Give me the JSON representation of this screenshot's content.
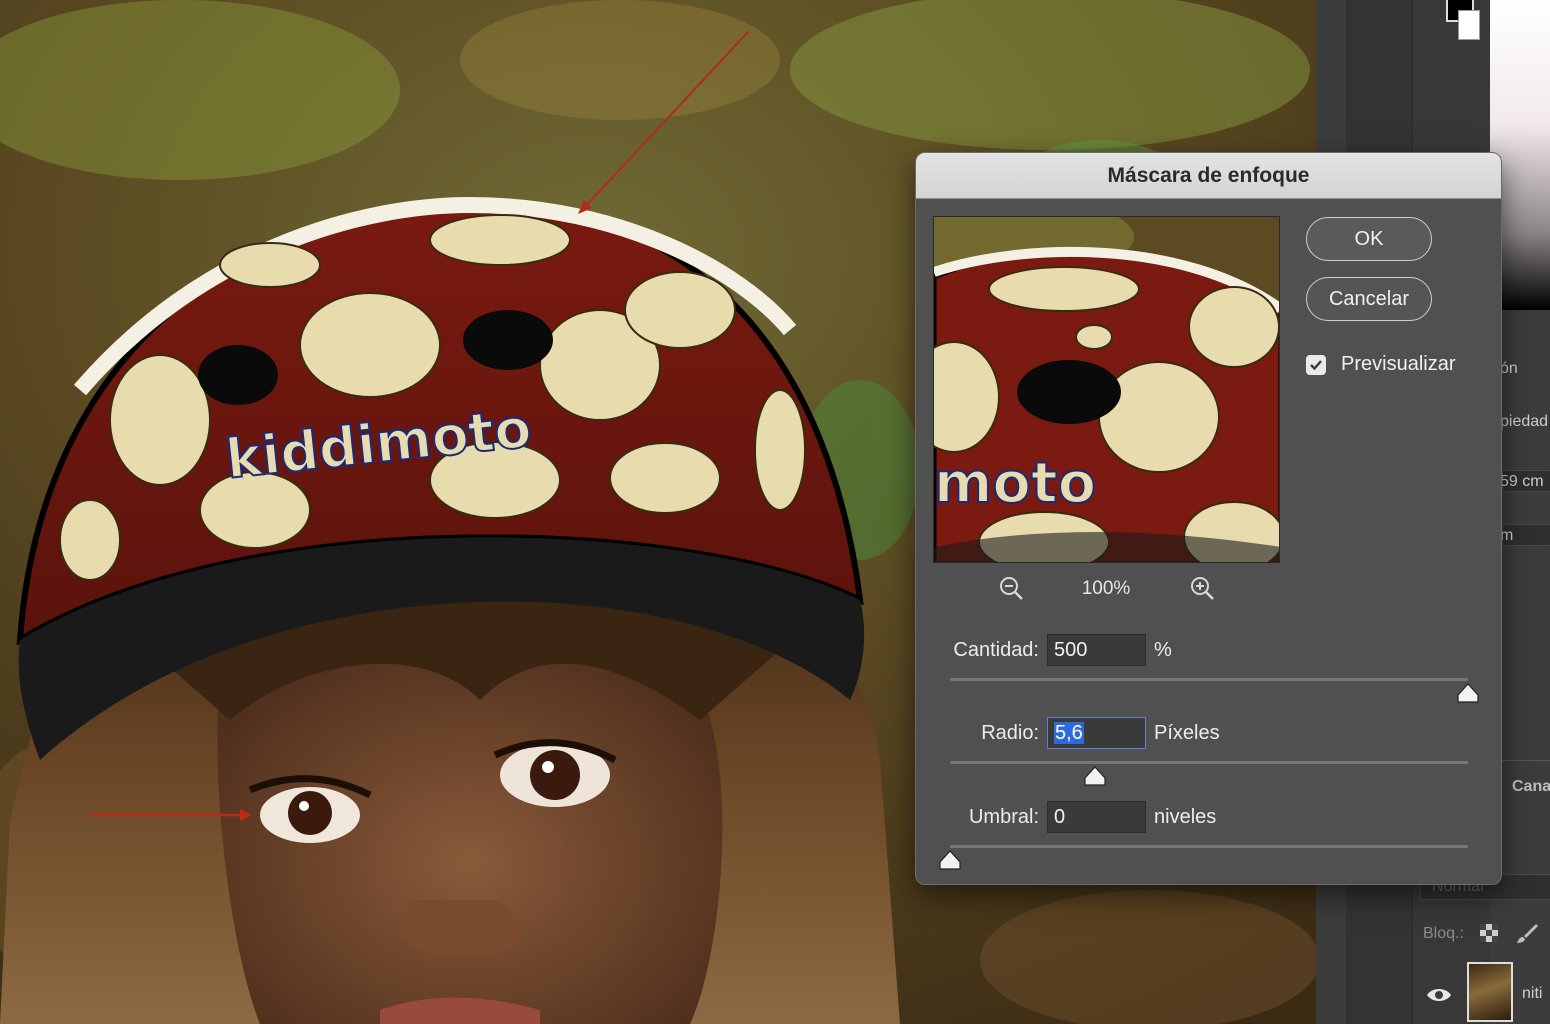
{
  "dialog": {
    "title": "Máscara de enfoque",
    "ok_label": "OK",
    "cancel_label": "Cancelar",
    "preview_label": "Previsualizar",
    "preview_checked": true,
    "zoom_level": "100%",
    "amount": {
      "label": "Cantidad:",
      "value": "500",
      "unit": "%",
      "slider_fraction": 1.0
    },
    "radius": {
      "label": "Radio:",
      "value": "5,6",
      "unit": "Píxeles",
      "slider_fraction": 0.28
    },
    "threshold": {
      "label": "Umbral:",
      "value": "0",
      "unit": "niveles",
      "slider_fraction": 0.0
    }
  },
  "canvas": {
    "helmet_brand_text": "kiddimoto",
    "preview_brand_text": "moto"
  },
  "panel": {
    "label_on": "ón",
    "label_properties": "piedad",
    "label_width": "59 cm",
    "label_m": "m",
    "label_channels": "Cana",
    "blend_mode": "Normal",
    "lock_label": "Bloq.:",
    "layer_name": "niti"
  },
  "colors": {
    "dialog_bg": "#505050",
    "titlebar": "#d9d9d9",
    "helmet_red": "#8a1e12",
    "dots": "#e8dcae",
    "selection": "#2f6bd8"
  },
  "icons": [
    "zoom-out-icon",
    "zoom-in-icon",
    "checkmark-icon",
    "eye-icon",
    "lock-transparency-icon",
    "brush-icon"
  ]
}
